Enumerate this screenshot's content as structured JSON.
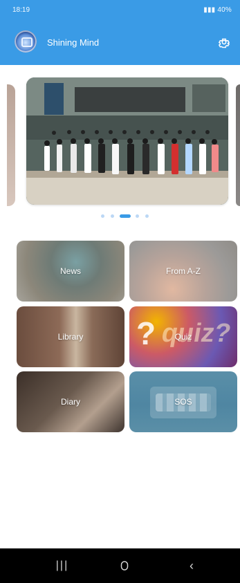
{
  "status_bar": {
    "time": "18:19",
    "right": "40%"
  },
  "header": {
    "app_name": "Shining Mind",
    "settings_icon": "gear-icon",
    "logo_icon": "school-logo-icon"
  },
  "carousel": {
    "active_index": 2,
    "dot_count": 5
  },
  "menu": {
    "items": [
      {
        "label": "News"
      },
      {
        "label": "From A-Z"
      },
      {
        "label": "Library"
      },
      {
        "label": "Quiz"
      },
      {
        "label": "Diary"
      },
      {
        "label": "SOS"
      }
    ]
  },
  "system_nav": {
    "recent_icon": "recent-apps-icon",
    "home_icon": "home-icon",
    "back_icon": "back-icon"
  }
}
